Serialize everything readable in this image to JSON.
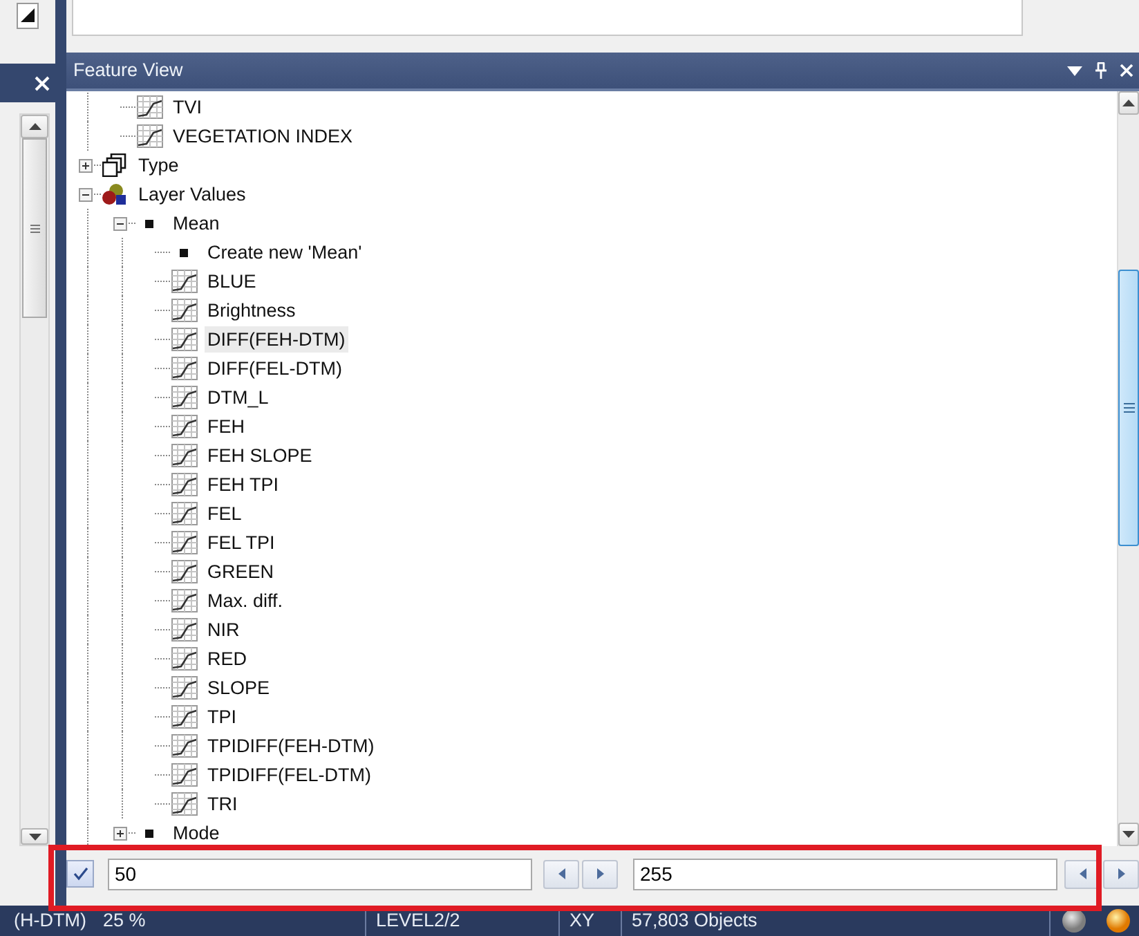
{
  "panel": {
    "title": "Feature View"
  },
  "tree": [
    {
      "kind": "continuation",
      "children": [
        {
          "kind": "feature",
          "label": "TVI",
          "selected": false
        },
        {
          "kind": "feature",
          "label": "VEGETATION INDEX",
          "selected": false
        }
      ]
    },
    {
      "kind": "type",
      "label": "Type",
      "expanded": false,
      "selected": false
    },
    {
      "kind": "layers",
      "label": "Layer Values",
      "expanded": true,
      "selected": false,
      "children": [
        {
          "kind": "bullet",
          "label": "Mean",
          "expanded": true,
          "selected": false,
          "children": [
            {
              "kind": "bullet",
              "label": "Create new 'Mean'",
              "selected": false
            },
            {
              "kind": "feature",
              "label": "BLUE",
              "selected": false
            },
            {
              "kind": "feature",
              "label": "Brightness",
              "selected": false
            },
            {
              "kind": "feature",
              "label": "DIFF(FEH-DTM)",
              "selected": true
            },
            {
              "kind": "feature",
              "label": "DIFF(FEL-DTM)",
              "selected": false
            },
            {
              "kind": "feature",
              "label": "DTM_L",
              "selected": false
            },
            {
              "kind": "feature",
              "label": "FEH",
              "selected": false
            },
            {
              "kind": "feature",
              "label": "FEH SLOPE",
              "selected": false
            },
            {
              "kind": "feature",
              "label": "FEH TPI",
              "selected": false
            },
            {
              "kind": "feature",
              "label": "FEL",
              "selected": false
            },
            {
              "kind": "feature",
              "label": "FEL TPI",
              "selected": false
            },
            {
              "kind": "feature",
              "label": "GREEN",
              "selected": false
            },
            {
              "kind": "feature",
              "label": "Max. diff.",
              "selected": false
            },
            {
              "kind": "feature",
              "label": "NIR",
              "selected": false
            },
            {
              "kind": "feature",
              "label": "RED",
              "selected": false
            },
            {
              "kind": "feature",
              "label": "SLOPE",
              "selected": false
            },
            {
              "kind": "feature",
              "label": "TPI",
              "selected": false
            },
            {
              "kind": "feature",
              "label": "TPIDIFF(FEH-DTM)",
              "selected": false
            },
            {
              "kind": "feature",
              "label": "TPIDIFF(FEL-DTM)",
              "selected": false
            },
            {
              "kind": "feature",
              "label": "TRI",
              "selected": false
            }
          ]
        },
        {
          "kind": "bullet",
          "label": "Mode",
          "expanded": false,
          "selected": false
        }
      ]
    }
  ],
  "range_bar": {
    "highlighted": true,
    "checked": true,
    "min": "50",
    "max": "255"
  },
  "status_bar": [
    {
      "texts": [
        "(H-DTM)",
        "25 %"
      ]
    },
    {
      "texts": [
        "LEVEL2/2"
      ]
    },
    {
      "texts": [
        "XY"
      ]
    },
    {
      "texts": [
        "57,803 Objects"
      ]
    }
  ]
}
